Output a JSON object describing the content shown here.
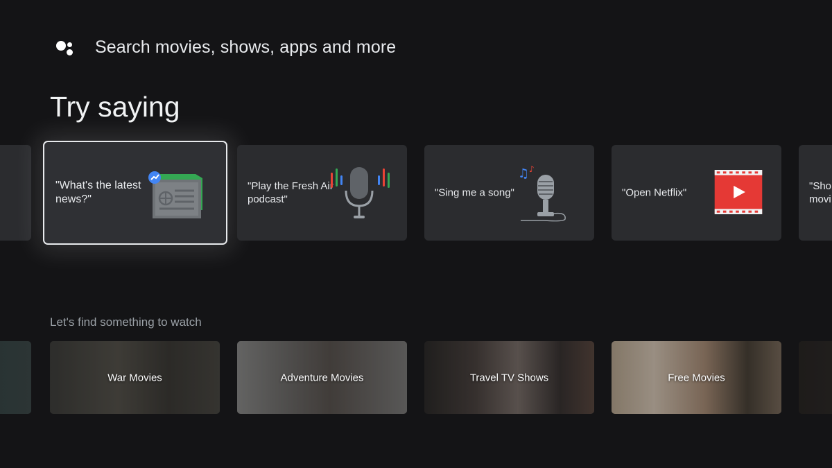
{
  "search": {
    "icon": "google-assistant-icon",
    "placeholder": "Search movies, shows, apps and more"
  },
  "try_saying": {
    "heading": "Try saying",
    "cards": [
      {
        "label": "",
        "icon": "turntable-icon"
      },
      {
        "label": "\"What's the latest news?\"",
        "icon": "newspaper-icon"
      },
      {
        "label": "\"Play the Fresh Air podcast\"",
        "icon": "podcast-microphone-icon"
      },
      {
        "label": "\"Sing me a song\"",
        "icon": "singing-microphone-icon"
      },
      {
        "label": "\"Open Netflix\"",
        "icon": "film-play-icon"
      },
      {
        "label": "\"Sho movi",
        "icon": ""
      }
    ]
  },
  "watch": {
    "heading": "Let's find something to watch",
    "tiles": [
      {
        "label": ""
      },
      {
        "label": "War Movies"
      },
      {
        "label": "Adventure Movies"
      },
      {
        "label": "Travel TV Shows"
      },
      {
        "label": "Free Movies"
      },
      {
        "label": ""
      }
    ]
  },
  "colors": {
    "background": "#141416",
    "card": "#2b2c2f",
    "focus_border": "#e8eaed",
    "netflix_red": "#e53935"
  }
}
